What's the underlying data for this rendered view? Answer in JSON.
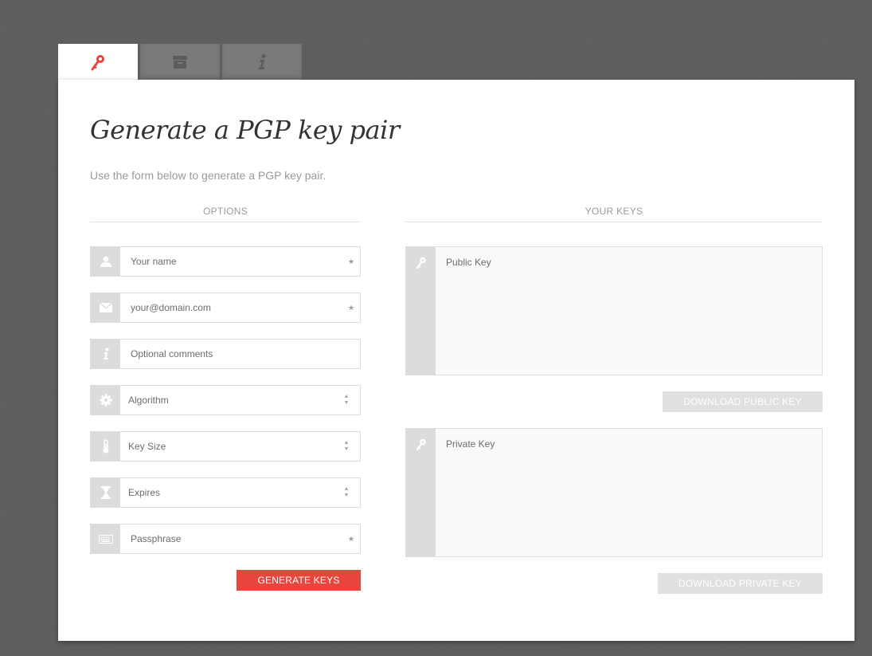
{
  "tabs": [
    {
      "icon": "key-icon",
      "active": true
    },
    {
      "icon": "archive-icon",
      "active": false
    },
    {
      "icon": "info-icon",
      "active": false
    }
  ],
  "title": "Generate a PGP key pair",
  "subtitle": "Use the form below to generate a PGP key pair.",
  "options": {
    "heading": "OPTIONS",
    "name_placeholder": "Your name",
    "email_placeholder": "your@domain.com",
    "comments_placeholder": "Optional comments",
    "algorithm_label": "Algorithm",
    "keysize_label": "Key Size",
    "expires_label": "Expires",
    "passphrase_placeholder": "Passphrase",
    "required_mark": "★",
    "generate_label": "GENERATE KEYS"
  },
  "keys": {
    "heading": "YOUR KEYS",
    "public_placeholder": "Public Key",
    "private_placeholder": "Private Key",
    "download_public_label": "DOWNLOAD PUBLIC KEY",
    "download_private_label": "DOWNLOAD PRIVATE KEY"
  },
  "colors": {
    "accent": "#e8453c",
    "disabled_button": "#e0e0e0",
    "icon_bg": "#dcdcdc"
  }
}
